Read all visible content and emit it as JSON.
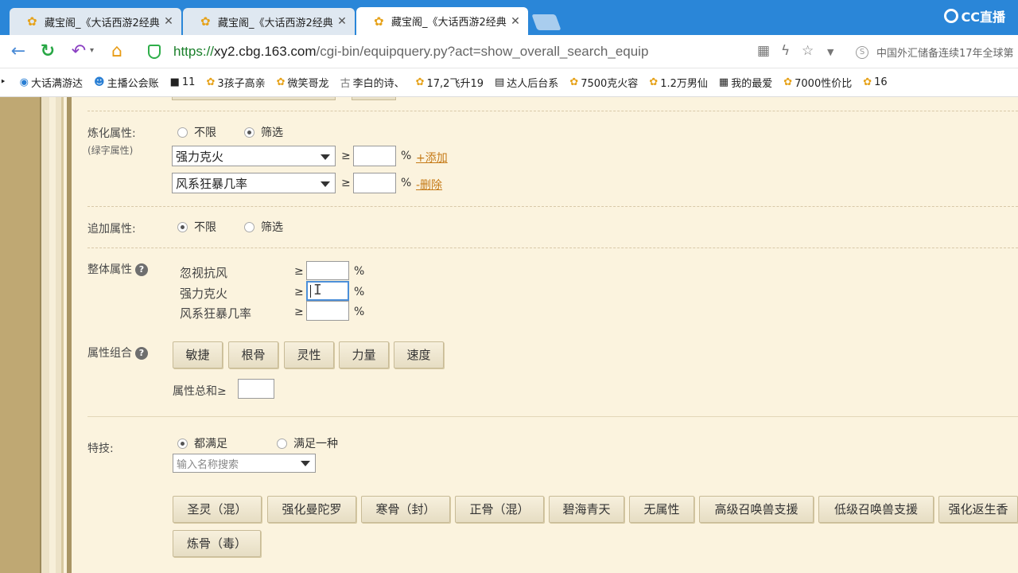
{
  "browser": {
    "tabs": [
      {
        "title": "藏宝阁_《大话西游2经典"
      },
      {
        "title": "藏宝阁_《大话西游2经典"
      },
      {
        "title": "藏宝阁_《大话西游2经典"
      }
    ],
    "logo_text": "CC直播",
    "url": {
      "scheme": "https://",
      "domain": "xy2.cbg.163.com",
      "path": "/cgi-bin/equipquery.py?act=show_overall_search_equip"
    },
    "news_text": "中国外汇储备连续17年全球第",
    "bookmarks": [
      "大话满游达",
      "主播公会账",
      "11",
      "3孩子高亲",
      "微笑哥龙",
      "李白的诗、",
      "17,2飞升19",
      "达人后台系",
      "7500克火容",
      "1.2万男仙",
      "我的最爱",
      "7000性价比",
      "16"
    ]
  },
  "refine": {
    "label": "炼化属性:",
    "sublabel": "(绿字属性)",
    "radio_unlimited": "不限",
    "radio_filter": "筛选",
    "row1_select": "强力克火",
    "row2_select": "风系狂暴几率",
    "ge": "≥",
    "pct": "%",
    "add_link": "+添加",
    "del_link": "-删除"
  },
  "append": {
    "label": "追加属性:",
    "radio_unlimited": "不限",
    "radio_filter": "筛选"
  },
  "overall": {
    "label": "整体属性",
    "help": "?",
    "rows": [
      {
        "name": "忽视抗风"
      },
      {
        "name": "强力克火"
      },
      {
        "name": "风系狂暴几率"
      }
    ],
    "ge": "≥",
    "pct": "%"
  },
  "combo": {
    "label": "属性组合",
    "help": "?",
    "buttons": [
      "敏捷",
      "根骨",
      "灵性",
      "力量",
      "速度"
    ],
    "sum_label": "属性总和≥"
  },
  "skill": {
    "label": "特技:",
    "radio_all": "都满足",
    "radio_one": "满足一种",
    "search_placeholder": "输入名称搜索",
    "buttons": [
      "圣灵（混）",
      "强化曼陀罗",
      "寒骨（封）",
      "正骨（混）",
      "碧海青天",
      "无属性",
      "高级召唤兽支援",
      "低级召唤兽支援",
      "强化返生香",
      "炼骨（毒）"
    ]
  }
}
